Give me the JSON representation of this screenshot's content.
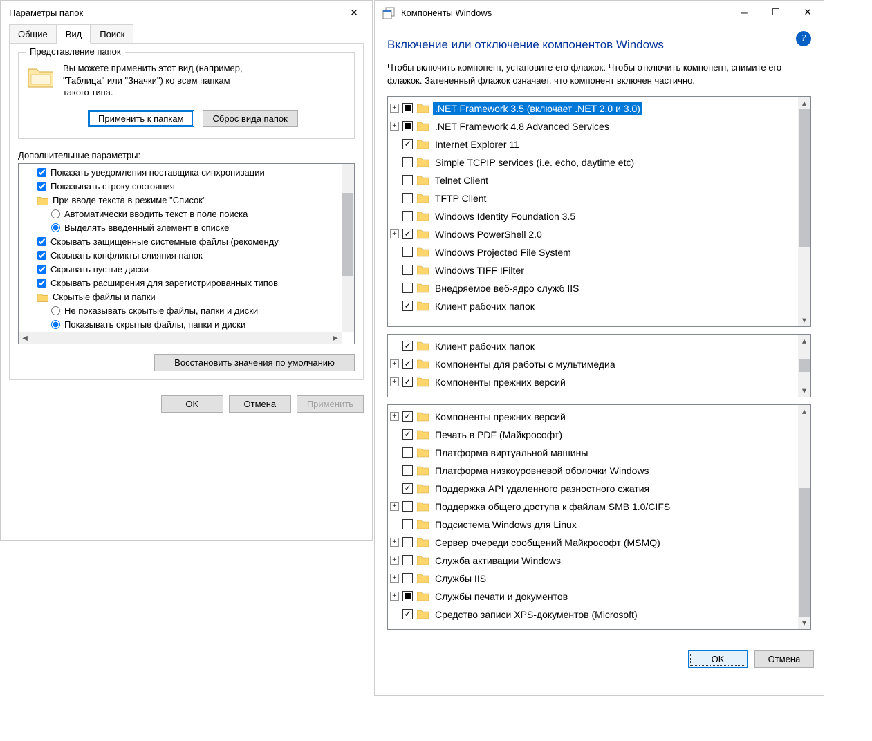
{
  "left": {
    "title": "Параметры папок",
    "tabs": {
      "general": "Общие",
      "view": "Вид",
      "search": "Поиск"
    },
    "group_legend": "Представление папок",
    "desc_l1": "Вы можете применить этот вид (например,",
    "desc_l2": "\"Таблица\" или \"Значки\") ко всем папкам",
    "desc_l3": "такого типа.",
    "apply_btn": "Применить к папкам",
    "reset_btn": "Сброс вида папок",
    "advanced_label": "Дополнительные параметры:",
    "adv": [
      {
        "t": "check",
        "c": true,
        "l": "Показать уведомления поставщика синхронизации",
        "i": 1
      },
      {
        "t": "check",
        "c": true,
        "l": "Показывать строку состояния",
        "i": 1
      },
      {
        "t": "folder",
        "l": "При вводе текста в режиме \"Список\"",
        "i": 1
      },
      {
        "t": "radio",
        "c": false,
        "l": "Автоматически вводить текст в поле поиска",
        "i": 2
      },
      {
        "t": "radio",
        "c": true,
        "l": "Выделять введенный элемент в списке",
        "i": 2
      },
      {
        "t": "check",
        "c": true,
        "l": "Скрывать защищенные системные файлы (рекоменду",
        "i": 1
      },
      {
        "t": "check",
        "c": true,
        "l": "Скрывать конфликты слияния папок",
        "i": 1
      },
      {
        "t": "check",
        "c": true,
        "l": "Скрывать пустые диски",
        "i": 1
      },
      {
        "t": "check",
        "c": true,
        "l": "Скрывать расширения для зарегистрированных типов",
        "i": 1
      },
      {
        "t": "folder",
        "l": "Скрытые файлы и папки",
        "i": 1
      },
      {
        "t": "radio",
        "c": false,
        "l": "Не показывать скрытые файлы, папки и диски",
        "i": 2
      },
      {
        "t": "radio",
        "c": true,
        "l": "Показывать скрытые файлы, папки и диски",
        "i": 2
      }
    ],
    "restore_btn": "Восстановить значения по умолчанию",
    "ok": "OK",
    "cancel": "Отмена",
    "apply": "Применить"
  },
  "right": {
    "title": "Компоненты Windows",
    "heading": "Включение или отключение компонентов Windows",
    "help_text": "Чтобы включить компонент, установите его флажок. Чтобы отключить компонент, снимите его флажок. Затененный флажок означает, что компонент включен частично.",
    "ok": "OK",
    "cancel": "Отмена",
    "tree1": [
      {
        "e": "+",
        "cb": "indet",
        "l": ".NET Framework 3.5 (включает .NET 2.0 и 3.0)",
        "sel": true
      },
      {
        "e": "+",
        "cb": "indet",
        "l": ".NET Framework 4.8 Advanced Services"
      },
      {
        "e": "",
        "cb": "checked",
        "l": "Internet Explorer 11"
      },
      {
        "e": "",
        "cb": "",
        "l": "Simple TCPIP services (i.e. echo, daytime etc)"
      },
      {
        "e": "",
        "cb": "",
        "l": "Telnet Client"
      },
      {
        "e": "",
        "cb": "",
        "l": "TFTP Client"
      },
      {
        "e": "",
        "cb": "",
        "l": "Windows Identity Foundation 3.5"
      },
      {
        "e": "+",
        "cb": "checked",
        "l": "Windows PowerShell 2.0"
      },
      {
        "e": "",
        "cb": "",
        "l": "Windows Projected File System"
      },
      {
        "e": "",
        "cb": "",
        "l": "Windows TIFF IFilter"
      },
      {
        "e": "",
        "cb": "",
        "l": "Внедряемое веб-ядро служб IIS"
      },
      {
        "e": "",
        "cb": "checked",
        "l": "Клиент рабочих папок"
      }
    ],
    "tree2": [
      {
        "e": "",
        "cb": "checked",
        "l": "Клиент рабочих папок"
      },
      {
        "e": "+",
        "cb": "checked",
        "l": "Компоненты для работы с мультимедиа"
      },
      {
        "e": "+",
        "cb": "checked",
        "l": "Компоненты прежних версий"
      }
    ],
    "tree3": [
      {
        "e": "+",
        "cb": "checked",
        "l": "Компоненты прежних версий"
      },
      {
        "e": "",
        "cb": "checked",
        "l": "Печать в PDF (Майкрософт)"
      },
      {
        "e": "",
        "cb": "",
        "l": "Платформа виртуальной машины"
      },
      {
        "e": "",
        "cb": "",
        "l": "Платформа низкоуровневой оболочки Windows"
      },
      {
        "e": "",
        "cb": "checked",
        "l": "Поддержка API удаленного разностного сжатия"
      },
      {
        "e": "+",
        "cb": "",
        "l": "Поддержка общего доступа к файлам SMB 1.0/CIFS"
      },
      {
        "e": "",
        "cb": "",
        "l": "Подсистема Windows для Linux"
      },
      {
        "e": "+",
        "cb": "",
        "l": "Сервер очереди сообщений Майкрософт (MSMQ)"
      },
      {
        "e": "+",
        "cb": "",
        "l": "Служба активации Windows"
      },
      {
        "e": "+",
        "cb": "",
        "l": "Службы IIS"
      },
      {
        "e": "+",
        "cb": "indet",
        "l": "Службы печати и документов"
      },
      {
        "e": "",
        "cb": "checked",
        "l": "Средство записи XPS-документов (Microsoft)"
      }
    ]
  }
}
